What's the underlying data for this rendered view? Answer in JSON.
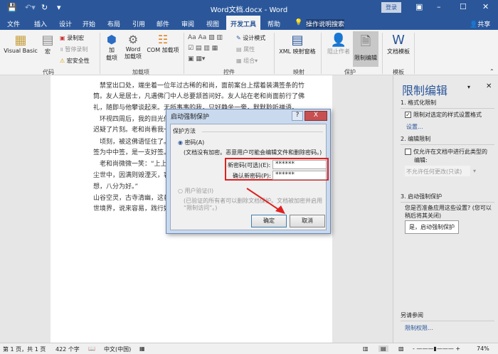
{
  "window": {
    "title": "Word文档.docx - Word",
    "login": "登录"
  },
  "tabs": [
    "文件",
    "插入",
    "设计",
    "开始",
    "布局",
    "引用",
    "邮件",
    "审阅",
    "视图",
    "开发工具",
    "帮助"
  ],
  "search": "操作说明搜索",
  "share": "共享",
  "ribbon": {
    "code": {
      "vb": "Visual Basic",
      "macro": "宏",
      "record": "录制宏",
      "pause": "暂停录制",
      "security": "宏安全性",
      "label": "代码"
    },
    "addins": {
      "addin_top": "加",
      "addin_bottom": "载项",
      "word_top": "Word",
      "word_bottom": "加载项",
      "com": "COM 加载项",
      "label": "加载项"
    },
    "controls": {
      "design": "设计模式",
      "props": "属性",
      "group": "组合",
      "label": "控件"
    },
    "mapping": {
      "xml": "XML 映射窗格",
      "label": "映射"
    },
    "protect": {
      "block": "阻止作者",
      "restrict": "限制编辑",
      "label": "保护"
    },
    "templates": {
      "doc": "文档模板",
      "label": "模板"
    }
  },
  "document": {
    "lines": [
      "　禁堂出口处，端坐着一位年过古稀的和尚，面前案台上摆着装满签条的竹",
      "筒。友人是居士，凡遇佛门中人总要颔首问好。友人站在老和尚面前行了佛",
      "礼，随即与他攀谈起来。无所事事的我，只好静坐一旁，默默聆听禅语。",
      "　环视四周后，我的目光停留在",
      "迟疑了片刻。老和尚看我一眼",
      "　顷刻，被这佛语怔住了。",
      "签为中中签，是一支好签。“",
      "　老和尚微微一笑：“上上",
      "尘世中，因满则毁湮灭，容易",
      "想，八分为好。”",
      "山谷空灵，古寺清幽，这番话",
      "世境界，说来容易，践行好难"
    ]
  },
  "dialog": {
    "title": "启动强制保护",
    "help": "?",
    "close": "X",
    "section": "保护方法",
    "password_option": "密码(A)",
    "password_note": "(文档没有加密。恶意用户可能会编辑文件和删除密码。)",
    "new_pw_label": "新密码(可选)(E):",
    "new_pw_value": "******",
    "confirm_pw_label": "确认新密码(P):",
    "confirm_pw_value": "******",
    "user_auth": "用户验证(I)",
    "user_auth_note1": "(已验证的所有者可以删除文档保护。文档被加密并启用",
    "user_auth_note2": "“限制访问”。)",
    "ok": "确定",
    "cancel": "取消"
  },
  "pane": {
    "title": "限制编辑",
    "s1": "1. 格式化限制",
    "s1_check": "限制对选定的样式设置格式",
    "s1_link": "设置...",
    "s2": "2. 编辑限制",
    "s2_check1": "仅允许在文档中进行此类型的",
    "s2_check2": "编辑:",
    "s2_select": "不允许任何更改(只读)",
    "s3": "3. 启动强制保护",
    "s3_q1": "您是否准备应用这些设置? (您可以",
    "s3_q2": "稍后将其关闭)",
    "s3_btn": "是，启动强制保护",
    "see_also": "另请参阅",
    "perm_link": "限制权限..."
  },
  "status": {
    "page": "第 1 页，共 1 页",
    "words": "422 个字",
    "lang": "中文(中国)",
    "zoom": "74%"
  },
  "colors": {
    "brand": "#2b579a",
    "highlight": "#e02020"
  }
}
